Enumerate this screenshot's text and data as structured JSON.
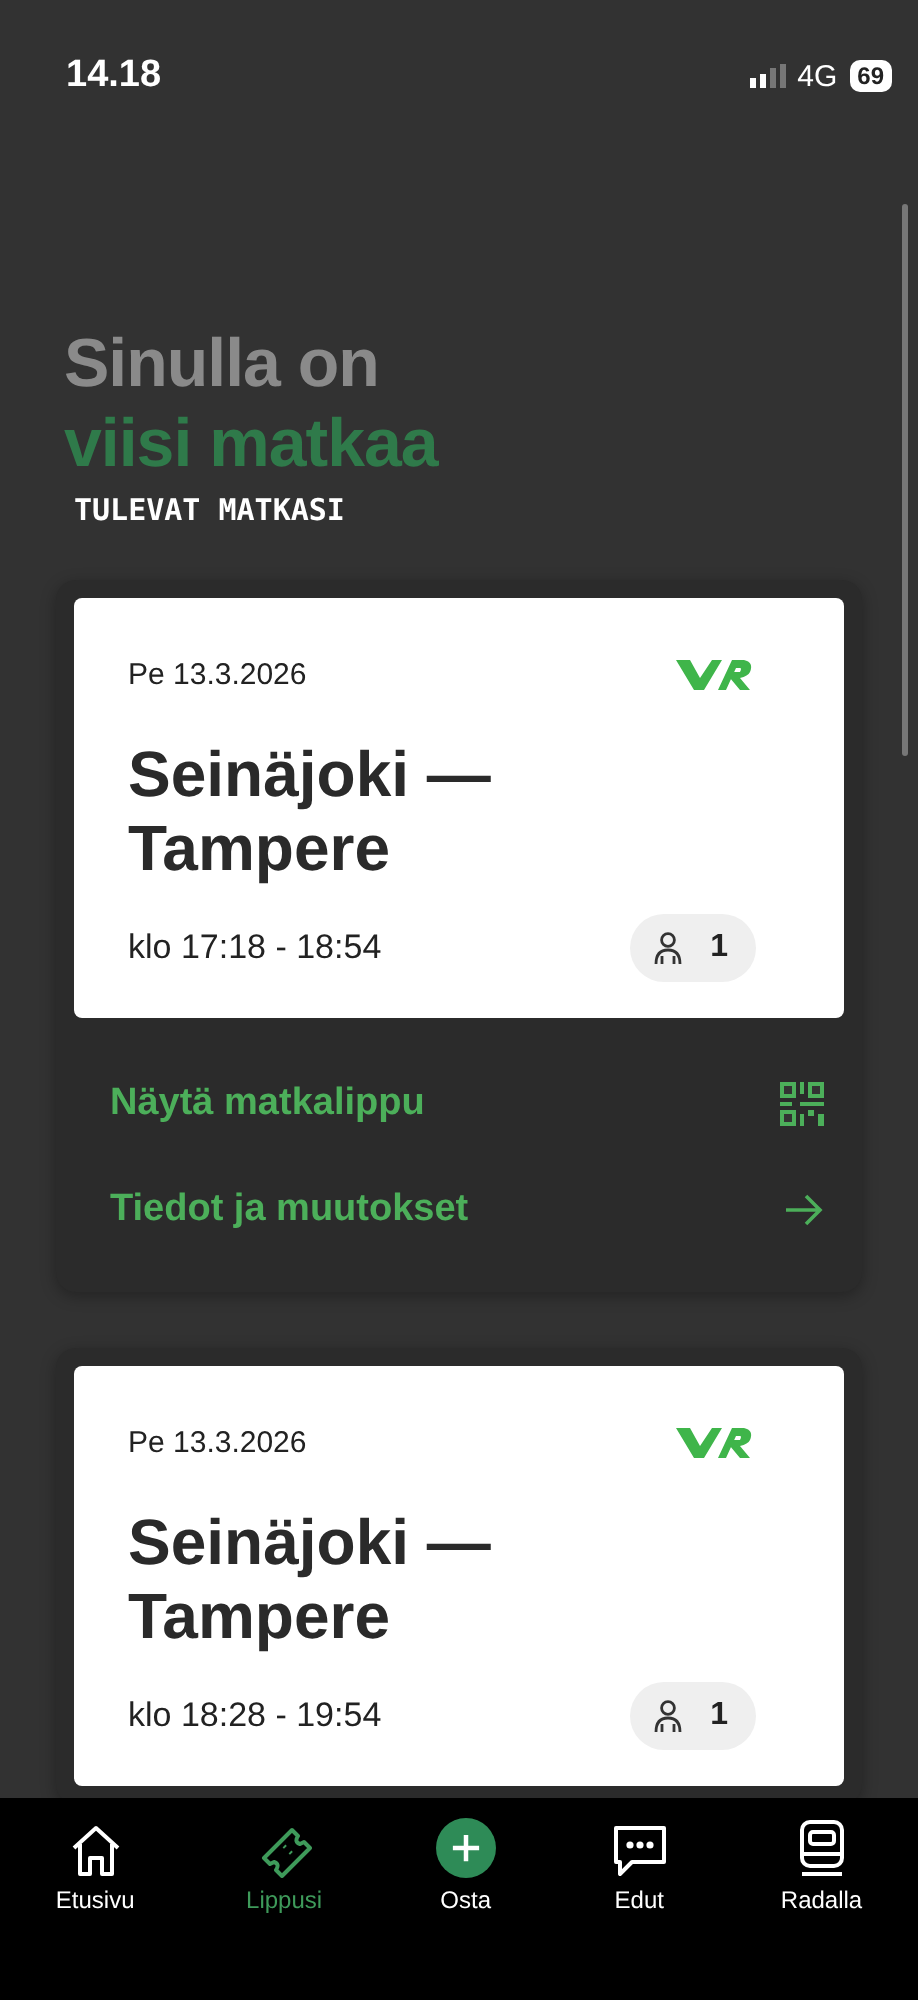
{
  "status_bar": {
    "time": "14.18",
    "network": "4G",
    "battery": "69"
  },
  "heading": {
    "line_1": "Sinulla on",
    "line_2": "viisi matkaa",
    "section_label": "TULEVAT MATKASI"
  },
  "trips": [
    {
      "date": "Pe 13.3.2026",
      "route": "Seinäjoki — Tampere",
      "time": "klo 17:18 - 18:54",
      "passengers": "1",
      "actions": [
        {
          "kind": "ticket",
          "label": "Näytä matkalippu"
        },
        {
          "kind": "details",
          "label": "Tiedot ja muutokset"
        }
      ]
    },
    {
      "date": "Pe 13.3.2026",
      "route": "Seinäjoki — Tampere",
      "time": "klo 18:28 - 19:54",
      "passengers": "1"
    }
  ],
  "tab_bar": [
    {
      "kind": "home",
      "label": "Etusivu",
      "selected": false
    },
    {
      "kind": "ticket",
      "label": "Lippusi",
      "selected": true
    },
    {
      "kind": "buy",
      "label": "Osta",
      "selected": false
    },
    {
      "kind": "benefits",
      "label": "Edut",
      "selected": false
    },
    {
      "kind": "train",
      "label": "Radalla",
      "selected": false
    }
  ]
}
